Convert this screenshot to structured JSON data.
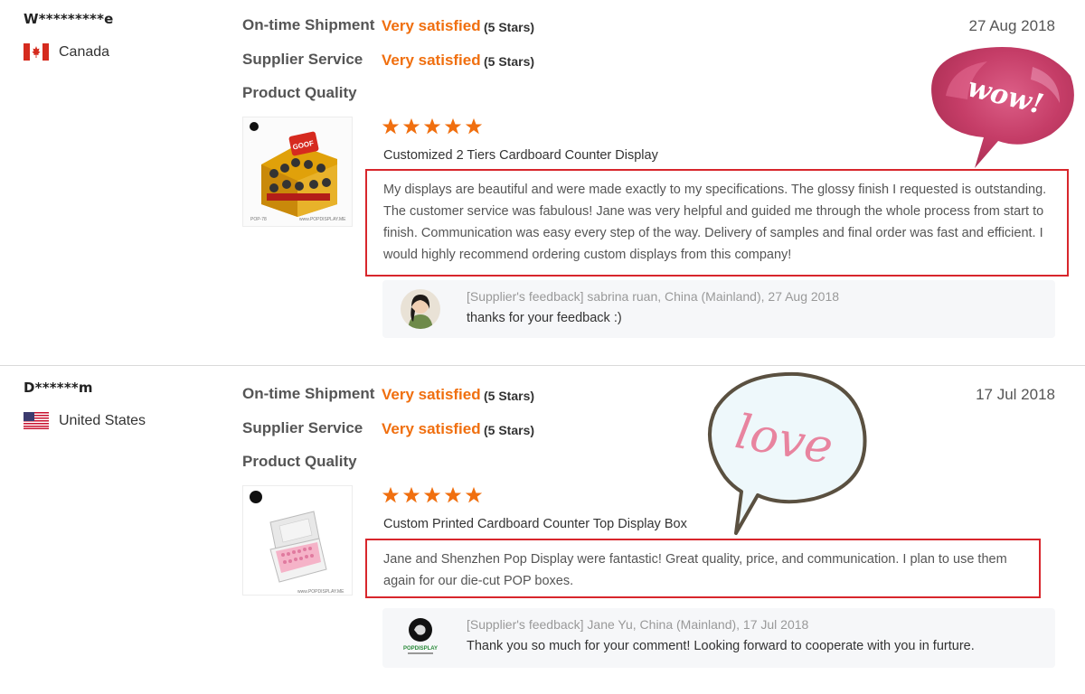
{
  "reviews": [
    {
      "buyer": "W*********e",
      "country": "Canada",
      "date": "27 Aug 2018",
      "ratings": [
        {
          "label": "On-time Shipment",
          "value": "Very satisfied",
          "stars": "(5 Stars)"
        },
        {
          "label": "Supplier Service",
          "value": "Very satisfied",
          "stars": "(5 Stars)"
        },
        {
          "label": "Product Quality"
        }
      ],
      "star_rating": 5,
      "product": "Customized 2 Tiers Cardboard Counter Display",
      "comment": "My displays are beautiful and were made exactly to my specifications. The glossy finish I requested is outstanding. The customer service was fabulous! Jane was very helpful and guided me through the whole process from start to finish. Communication was easy every step of the way. Delivery of samples and final order was fast and efficient. I would highly recommend ordering custom displays from this company!",
      "feedback_meta": "[Supplier's feedback] sabrina ruan, China (Mainland), 27 Aug 2018",
      "feedback_text": "thanks for your feedback :)",
      "sticker": "wow!"
    },
    {
      "buyer": "D******m",
      "country": "United States",
      "date": "17 Jul 2018",
      "ratings": [
        {
          "label": "On-time Shipment",
          "value": "Very satisfied",
          "stars": "(5 Stars)"
        },
        {
          "label": "Supplier Service",
          "value": "Very satisfied",
          "stars": "(5 Stars)"
        },
        {
          "label": "Product Quality"
        }
      ],
      "star_rating": 5,
      "product": "Custom Printed Cardboard Counter Top Display Box",
      "comment": "Jane and Shenzhen Pop Display were fantastic! Great quality, price, and communication. I plan to use them again for our die-cut POP boxes.",
      "feedback_meta": "[Supplier's feedback] Jane Yu, China (Mainland), 17 Jul 2018",
      "feedback_text": "Thank you so much for your comment! Looking forward to cooperate with you in furture.",
      "sticker": "love"
    }
  ],
  "colors": {
    "accent": "#f06f0f",
    "highlight": "#d8262c",
    "star": "#f06f0f"
  },
  "icons": [
    "canada-flag-icon",
    "us-flag-icon",
    "star-icon"
  ]
}
